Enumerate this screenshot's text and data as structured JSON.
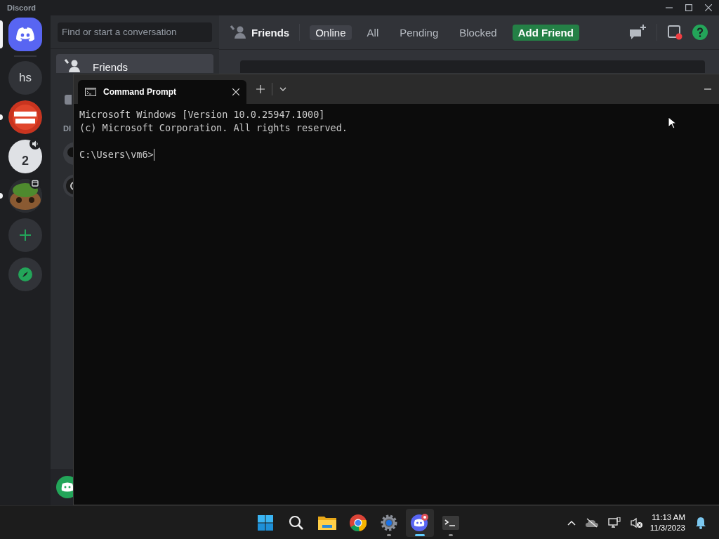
{
  "app_title": "Discord",
  "servers": [
    {
      "kind": "home",
      "selected": true
    },
    {
      "kind": "text",
      "label": "hs",
      "selected": false,
      "unread": false
    },
    {
      "kind": "picture",
      "selected": false,
      "unread": true
    },
    {
      "kind": "text",
      "label": "2",
      "selected": false,
      "unread": false,
      "voice_active": true
    },
    {
      "kind": "picture",
      "selected": false,
      "unread": true,
      "event_scheduled": true
    },
    {
      "kind": "add",
      "selected": false,
      "unread": false
    },
    {
      "kind": "explore",
      "selected": false,
      "unread": false
    }
  ],
  "dm_sidebar": {
    "search_placeholder": "Find or start a conversation",
    "items": [
      {
        "label": "Friends",
        "selected": true
      }
    ],
    "section_label": "DI"
  },
  "header": {
    "title": "Friends",
    "tabs": [
      {
        "label": "Online",
        "selected": true
      },
      {
        "label": "All",
        "selected": false
      },
      {
        "label": "Pending",
        "selected": false
      },
      {
        "label": "Blocked",
        "selected": false
      }
    ],
    "add_friend": "Add Friend"
  },
  "terminal": {
    "tab_title": "Command Prompt",
    "lines": [
      "Microsoft Windows [Version 10.0.25947.1000]",
      "(c) Microsoft Corporation. All rights reserved."
    ],
    "prompt": "C:\\Users\\vm6>"
  },
  "taskbar": {
    "apps": [
      {
        "kind": "start",
        "running": false,
        "active": false
      },
      {
        "kind": "search",
        "running": false,
        "active": false
      },
      {
        "kind": "explorer",
        "running": false,
        "active": false
      },
      {
        "kind": "chrome",
        "running": false,
        "active": false
      },
      {
        "kind": "settings",
        "running": true,
        "active": false
      },
      {
        "kind": "discord",
        "running": true,
        "active": true
      },
      {
        "kind": "terminal",
        "running": true,
        "active": false
      }
    ],
    "time": "11:13 AM",
    "date": "11/3/2023"
  }
}
